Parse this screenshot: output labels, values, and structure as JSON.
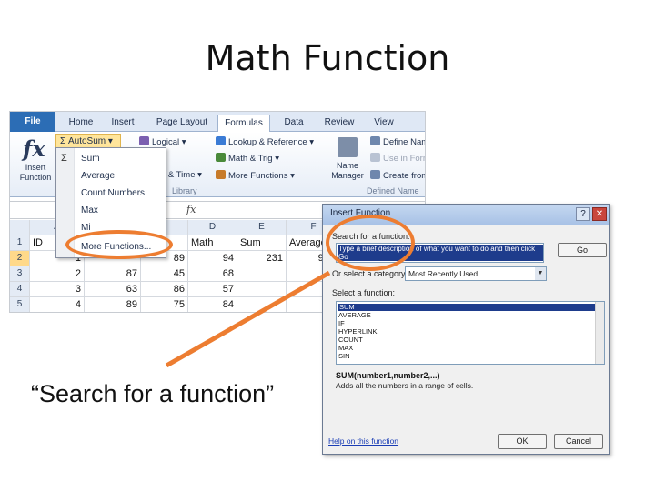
{
  "slide": {
    "title": "Math Function",
    "caption": "“Search for a function”"
  },
  "colors": {
    "highlight_oval": "#ed7d31",
    "ribbon_file_tab": "#2c6db5"
  },
  "excel": {
    "tabs": [
      "File",
      "Home",
      "Insert",
      "Page Layout",
      "Formulas",
      "Data",
      "Review",
      "View"
    ],
    "active_tab": "Formulas",
    "ribbon": {
      "insert_function": "Insert Function",
      "autosum": "AutoSum",
      "logical": "Logical",
      "lookup_reference": "Lookup & Reference",
      "date_time": "e & Time",
      "math_trig": "Math & Trig",
      "more_functions": "More Functions",
      "library_group": "Library",
      "name_manager": "Name Manager",
      "define_name": "Define Nam",
      "use_in_formula": "Use in Form",
      "create_from": "Create from",
      "defined_names_group": "Defined Name"
    },
    "formula_bar_fx": "fx",
    "autosum_menu": {
      "sigma": "Σ",
      "items": [
        "Sum",
        "Average",
        "Count Numbers",
        "Max",
        "Mi",
        "More Functions..."
      ]
    },
    "grid": {
      "col_headers": [
        "A",
        "D",
        "E",
        "F"
      ],
      "rows": [
        {
          "num": "1",
          "a": "ID",
          "c": "",
          "d": "Math",
          "e": "Sum",
          "f": "Average"
        },
        {
          "num": "2",
          "a": "1",
          "b": "",
          "c": "89",
          "d": "94",
          "e": "231",
          "f": "93.6"
        },
        {
          "num": "3",
          "a": "2",
          "b": "87",
          "c": "45",
          "d": "68",
          "e": "",
          "f": ""
        },
        {
          "num": "4",
          "a": "3",
          "b": "63",
          "c": "86",
          "d": "57",
          "e": "",
          "f": ""
        },
        {
          "num": "5",
          "a": "4",
          "b": "89",
          "c": "75",
          "d": "84",
          "e": "",
          "f": ""
        }
      ]
    }
  },
  "dialog": {
    "title": "Insert Function",
    "help_button": "?",
    "close_button": "✕",
    "search_label": "Search for a function:",
    "search_value": "Type a brief description of what you want to do and then click Go",
    "go_button": "Go",
    "category_label": "Or select a category:",
    "category_value": "Most Recently Used",
    "select_label": "Select a function:",
    "functions": [
      "SUM",
      "AVERAGE",
      "IF",
      "HYPERLINK",
      "COUNT",
      "MAX",
      "SIN"
    ],
    "selected_function": "SUM",
    "signature": "SUM(number1,number2,...)",
    "description": "Adds all the numbers in a range of cells.",
    "help_link": "Help on this function",
    "ok_button": "OK",
    "cancel_button": "Cancel"
  }
}
